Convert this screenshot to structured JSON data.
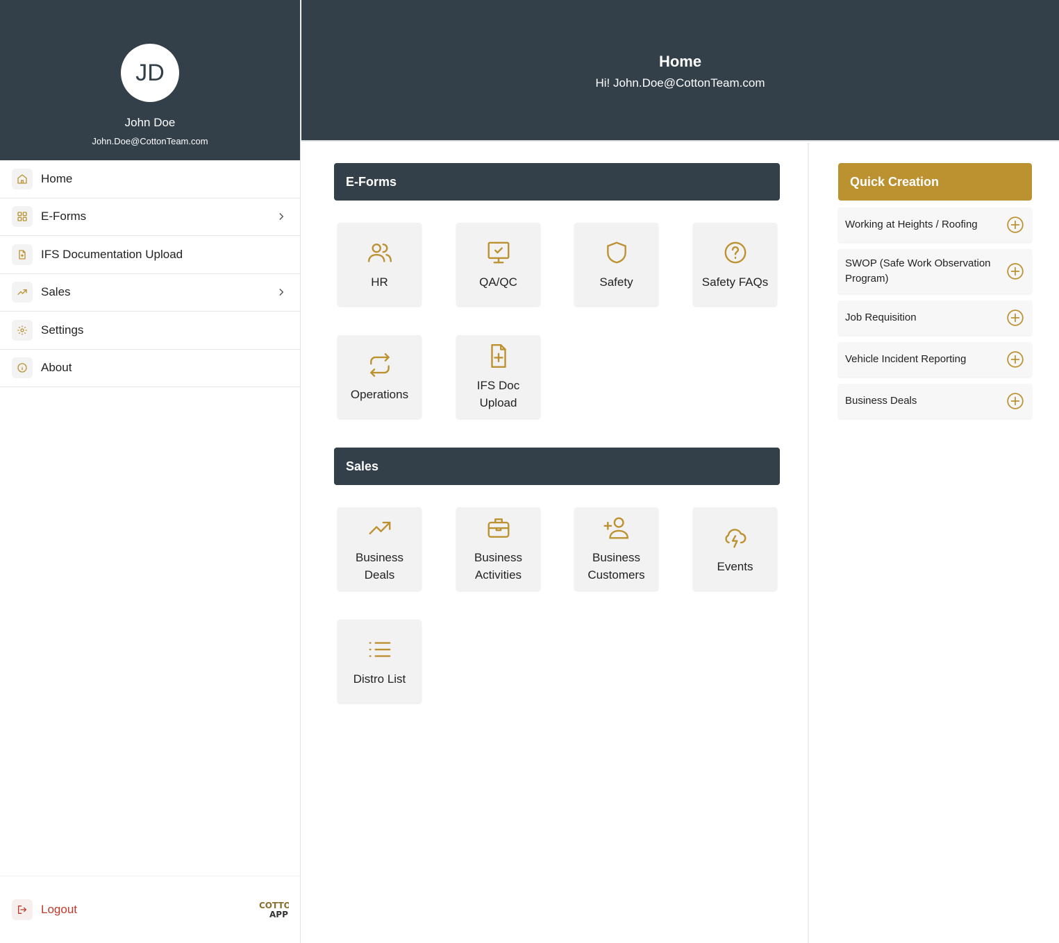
{
  "profile": {
    "initials": "JD",
    "name": "John Doe",
    "email": "John.Doe@CottonTeam.com"
  },
  "nav": {
    "items": [
      {
        "label": "Home",
        "icon": "home-icon"
      },
      {
        "label": "E-Forms",
        "icon": "grid-icon"
      },
      {
        "label": "IFS Documentation Upload",
        "icon": "file-plus-icon"
      },
      {
        "label": "Sales",
        "icon": "trending-up-icon"
      },
      {
        "label": "Settings",
        "icon": "gear-icon"
      },
      {
        "label": "About",
        "icon": "info-icon"
      }
    ],
    "logout": "Logout"
  },
  "header": {
    "title": "Home",
    "subtitle": "Hi! John.Doe@CottonTeam.com"
  },
  "eforms": {
    "title": "E-Forms",
    "tiles": [
      {
        "label": "HR",
        "icon": "users-icon"
      },
      {
        "label": "QA/QC",
        "icon": "monitor-check-icon"
      },
      {
        "label": "Safety",
        "icon": "shield-icon"
      },
      {
        "label": "Safety FAQs",
        "icon": "question-circle-icon"
      },
      {
        "label": "Operations",
        "icon": "repeat-icon"
      },
      {
        "label": "IFS Doc\nUpload",
        "icon": "file-plus-icon"
      }
    ]
  },
  "sales": {
    "title": "Sales",
    "tiles": [
      {
        "label": "Business\nDeals",
        "icon": "trending-up-icon"
      },
      {
        "label": "Business\nActivities",
        "icon": "briefcase-icon"
      },
      {
        "label": "Business\nCustomers",
        "icon": "user-plus-icon"
      },
      {
        "label": "Events",
        "icon": "cloud-lightning-icon"
      },
      {
        "label": "Distro List",
        "icon": "list-icon"
      }
    ]
  },
  "quick": {
    "title": "Quick Creation",
    "items": [
      "Working at Heights / Roofing",
      "SWOP (Safe Work Observation Program)",
      "Job Requisition",
      "Vehicle Incident Reporting",
      "Business Deals"
    ]
  },
  "colors": {
    "dark": "#333f49",
    "gold": "#bc9130",
    "logout": "#c0392b"
  }
}
